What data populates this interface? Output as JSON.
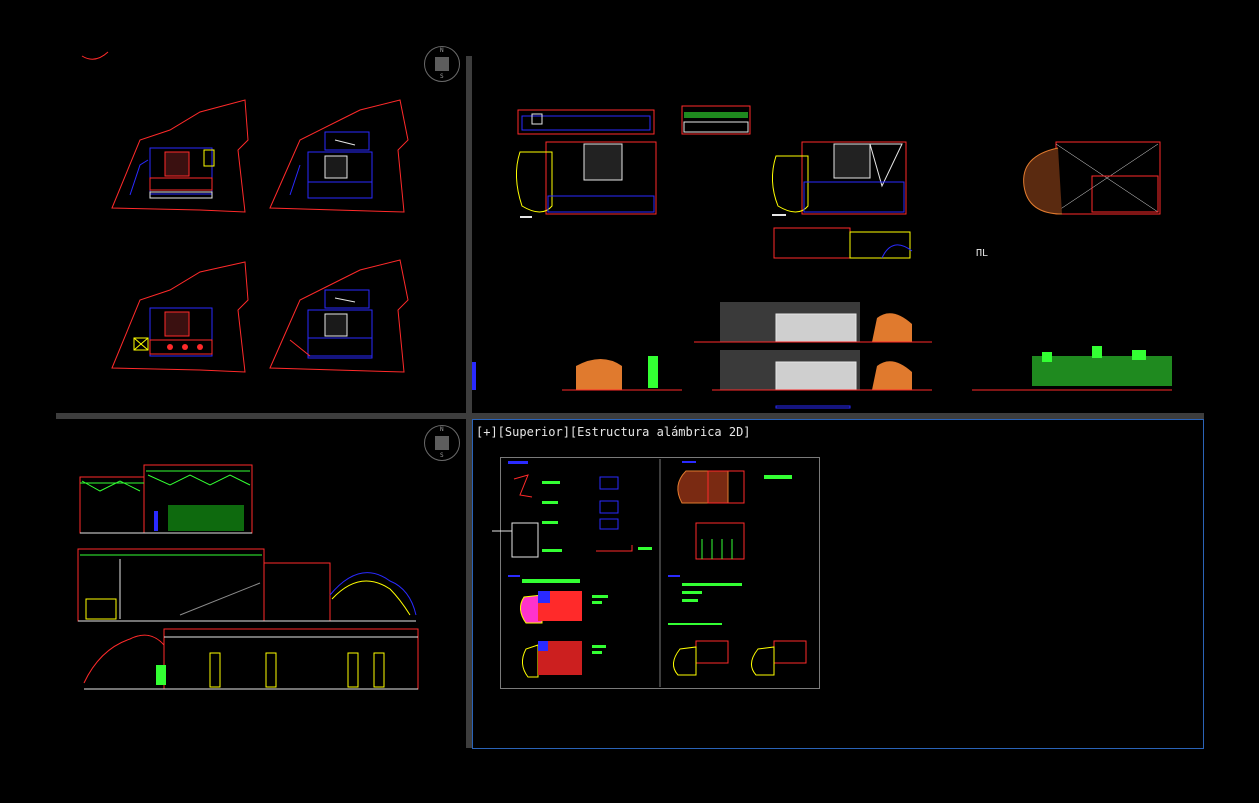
{
  "app": {
    "drawing_area_background": "#000000",
    "accent_colors": {
      "red": "#ff2a2a",
      "blue": "#2a2aff",
      "yellow": "#ffff00",
      "green": "#33ff33",
      "white": "#e6e6e6",
      "gray": "#8c8c8c",
      "orange": "#e07a2e",
      "magenta": "#ff33cc",
      "viewport_active_border": "#2a63b8"
    }
  },
  "viewports": {
    "top_left": {
      "viewcube_icon": "viewcube-compass-icon"
    },
    "top_right": {
      "text_mark": "ΠL"
    },
    "bottom_left": {
      "viewcube_icon": "viewcube-compass-icon"
    },
    "bottom_right": {
      "label": "[+][Superior][Estructura alámbrica 2D]",
      "active": true
    }
  },
  "viewcube": {
    "n": "N",
    "s": "S",
    "e": "E",
    "w": "O"
  }
}
